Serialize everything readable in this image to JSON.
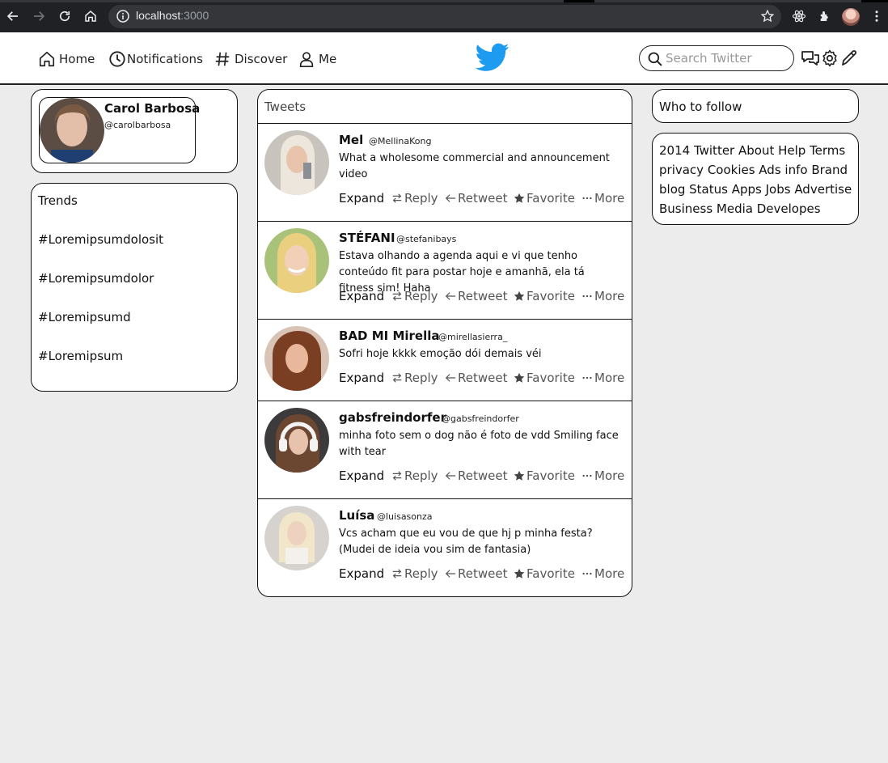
{
  "browser": {
    "url_host": "localhost",
    "url_port": ":3000"
  },
  "nav": {
    "home_label": "Home",
    "notifications_label": "Notifications",
    "discover_label": "Discover",
    "me_label": "Me",
    "search_placeholder": "Search Twitter",
    "logo_color": "#1d9bf0"
  },
  "profile": {
    "name": "Carol Barbosa",
    "handle": "@carolbarbosa"
  },
  "trends": {
    "title": "Trends",
    "items": [
      "#Loremipsumdolosit",
      "#Loremipsumdolor",
      "#Loremipsumd",
      "#Loremipsum"
    ]
  },
  "tweets": {
    "title": "Tweets",
    "actions": {
      "expand": "Expand",
      "reply": "Reply",
      "retweet": "Retweet",
      "favorite": "Favorite",
      "more": "More"
    },
    "items": [
      {
        "name": "Mel",
        "handle": "@MellinaKong",
        "text": "What a wholesome commercial and announcement video"
      },
      {
        "name": "STÉFANI",
        "handle": "@stefanibays",
        "text": "Estava olhando a agenda aqui e vi que tenho conteúdo fit para postar hoje e amanhã, ela tá fitness sim! Haha"
      },
      {
        "name": "BAD MI Mirella",
        "handle": "@mirellasierra_",
        "text": "Sofri hoje kkkk emoção dói demais véi"
      },
      {
        "name": "gabsfreindorfer",
        "handle": "@gabsfreindorfer",
        "text": "minha foto sem o dog não é foto de vdd Smiling face with tear"
      },
      {
        "name": "Luísa",
        "handle": "@luisasonza",
        "text": "Vcs acham que eu vou de que hj p minha festa? (Mudei de ideia vou sim de fantasia)"
      }
    ]
  },
  "who_to_follow": {
    "title": "Who to follow"
  },
  "footer": {
    "text": "2014 Twitter About Help Terms privacy Cookies Ads info Brand blog Status Apps Jobs Advertise Business Media Developes"
  }
}
